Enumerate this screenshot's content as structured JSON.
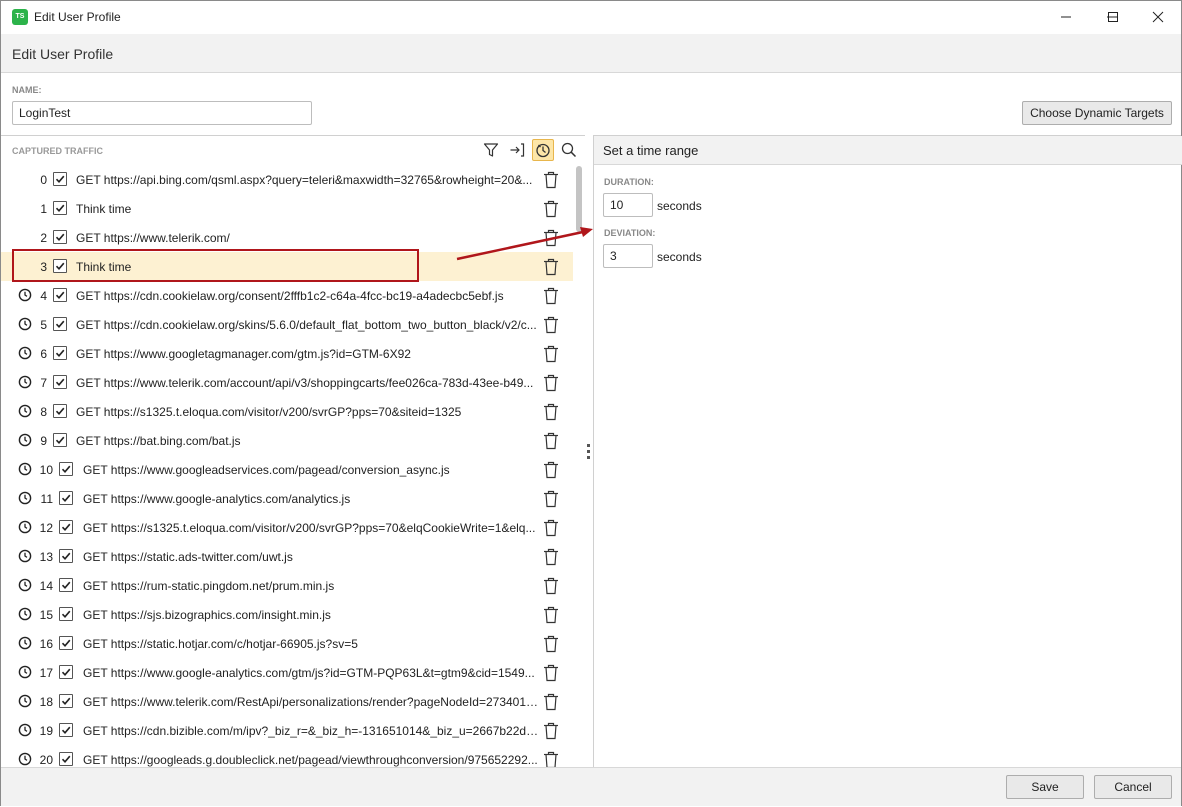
{
  "window": {
    "title": "Edit User Profile",
    "app_icon_text": "TS",
    "header_title": "Edit User Profile"
  },
  "name_field": {
    "label": "NAME:",
    "value": "LoginTest"
  },
  "buttons": {
    "choose_dynamic_targets": "Choose Dynamic Targets",
    "save": "Save",
    "cancel": "Cancel"
  },
  "captured_traffic": {
    "label": "CAPTURED TRAFFIC",
    "rows": [
      {
        "index": "0",
        "text": "GET https://api.bing.com/qsml.aspx?query=teleri&maxwidth=32765&rowheight=20&...",
        "clock": false,
        "checked": true
      },
      {
        "index": "1",
        "text": "Think time",
        "clock": false,
        "checked": true
      },
      {
        "index": "2",
        "text": "GET https://www.telerik.com/",
        "clock": false,
        "checked": true
      },
      {
        "index": "3",
        "text": "Think time",
        "clock": false,
        "checked": true,
        "selected": true
      },
      {
        "index": "4",
        "text": "GET https://cdn.cookielaw.org/consent/2fffb1c2-c64a-4fcc-bc19-a4adecbc5ebf.js",
        "clock": true,
        "checked": true
      },
      {
        "index": "5",
        "text": "GET https://cdn.cookielaw.org/skins/5.6.0/default_flat_bottom_two_button_black/v2/c...",
        "clock": true,
        "checked": true
      },
      {
        "index": "6",
        "text": "GET https://www.googletagmanager.com/gtm.js?id=GTM-6X92",
        "clock": true,
        "checked": true
      },
      {
        "index": "7",
        "text": "GET https://www.telerik.com/account/api/v3/shoppingcarts/fee026ca-783d-43ee-b49...",
        "clock": true,
        "checked": true
      },
      {
        "index": "8",
        "text": "GET https://s1325.t.eloqua.com/visitor/v200/svrGP?pps=70&siteid=1325",
        "clock": true,
        "checked": true
      },
      {
        "index": "9",
        "text": "GET https://bat.bing.com/bat.js",
        "clock": true,
        "checked": true
      },
      {
        "index": "10",
        "text": "GET https://www.googleadservices.com/pagead/conversion_async.js",
        "clock": true,
        "checked": true
      },
      {
        "index": "11",
        "text": "GET https://www.google-analytics.com/analytics.js",
        "clock": true,
        "checked": true
      },
      {
        "index": "12",
        "text": "GET https://s1325.t.eloqua.com/visitor/v200/svrGP?pps=70&elqCookieWrite=1&elq...",
        "clock": true,
        "checked": true
      },
      {
        "index": "13",
        "text": "GET https://static.ads-twitter.com/uwt.js",
        "clock": true,
        "checked": true
      },
      {
        "index": "14",
        "text": "GET https://rum-static.pingdom.net/prum.min.js",
        "clock": true,
        "checked": true
      },
      {
        "index": "15",
        "text": "GET https://sjs.bizographics.com/insight.min.js",
        "clock": true,
        "checked": true
      },
      {
        "index": "16",
        "text": "GET https://static.hotjar.com/c/hotjar-66905.js?sv=5",
        "clock": true,
        "checked": true
      },
      {
        "index": "17",
        "text": "GET https://www.google-analytics.com/gtm/js?id=GTM-PQP63L&t=gtm9&cid=1549...",
        "clock": true,
        "checked": true
      },
      {
        "index": "18",
        "text": "GET https://www.telerik.com/RestApi/personalizations/render?pageNodeId=273401f...",
        "clock": true,
        "checked": true
      },
      {
        "index": "19",
        "text": "GET https://cdn.bizible.com/m/ipv?_biz_r=&_biz_h=-131651014&_biz_u=2667b22d3...",
        "clock": true,
        "checked": true
      },
      {
        "index": "20",
        "text": "GET https://googleads.g.doubleclick.net/pagead/viewthroughconversion/975652292...",
        "clock": true,
        "checked": true
      }
    ]
  },
  "time_range": {
    "title": "Set a time range",
    "duration_label": "DURATION:",
    "duration_value": "10",
    "duration_unit": "seconds",
    "deviation_label": "DEVIATION:",
    "deviation_value": "3",
    "deviation_unit": "seconds"
  },
  "colors": {
    "accent_highlight": "#fdf1d2",
    "callout_red": "#b0161b",
    "app_icon_green": "#2cb34a",
    "active_tool": "#fde6a8"
  }
}
